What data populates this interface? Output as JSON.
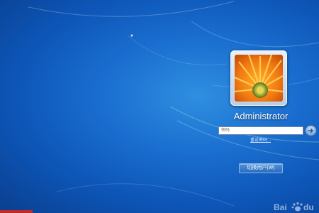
{
  "login": {
    "username": "Administrator",
    "password_placeholder": "密码",
    "reset_link": "重设密码...",
    "switch_user_button": "切换用户(W)"
  },
  "icons": {
    "submit": "arrow-right-icon",
    "avatar": "orange-flower-avatar"
  },
  "watermark": {
    "text": "Bai du"
  },
  "colors": {
    "background": "#1a6ecf",
    "accent_red": "#c02a2a"
  }
}
